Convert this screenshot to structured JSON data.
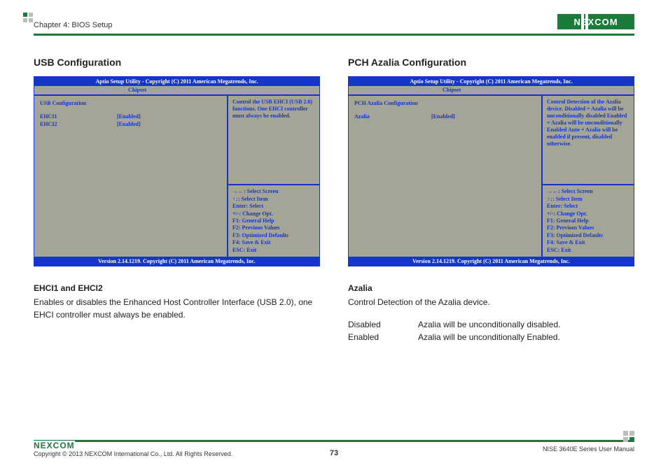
{
  "header": {
    "chapter": "Chapter 4: BIOS Setup",
    "logo": "NEXCOM"
  },
  "left": {
    "title": "USB Configuration",
    "bios": {
      "header": "Aptio Setup Utility - Copyright (C) 2011 American Megatrends, Inc.",
      "tab": "Chipset",
      "section": "USB Configuration",
      "rows": [
        {
          "label": "EHCI1",
          "value": "[Enabled]"
        },
        {
          "label": "EHCI2",
          "value": "[Enabled]"
        }
      ],
      "help": "Control the USB EHCI (USB 2.0) functions. One EHCI controller must always be enabled.",
      "keys": "→←: Select Screen\n↑↓: Select Item\nEnter: Select\n+/-: Change Opt.\nF1: General Help\nF2: Previous Values\nF3: Optimized Defaults\nF4: Save & Exit\nESC: Exit",
      "footer": "Version 2.14.1219. Copyright (C) 2011 American Megatrends, Inc."
    },
    "desc": {
      "heading": "EHCI1 and EHCI2",
      "body": "Enables or disables the Enhanced Host Controller Interface (USB 2.0), one EHCI controller must always be enabled."
    }
  },
  "right": {
    "title": "PCH Azalia Configuration",
    "bios": {
      "header": "Aptio Setup Utility - Copyright (C) 2011 American Megatrends, Inc.",
      "tab": "Chipset",
      "section": "PCH Azalia Configuration",
      "rows": [
        {
          "label": "Azalia",
          "value": "[Enabled]"
        }
      ],
      "help": "Control Detection of the Azalia device. Disabled = Azalia will be unconditionally disabled Enabled = Azalia will be unconditionally Enabled Auto = Azalia will be enabled if present, disabled otherwise.",
      "keys": "→←: Select Screen\n↑↓: Select Item\nEnter: Select\n+/-: Change Opt.\nF1: General Help\nF2: Previous Values\nF3: Optimized Defaults\nF4: Save & Exit\nESC: Exit",
      "footer": "Version 2.14.1219. Copyright (C) 2011 American Megatrends, Inc."
    },
    "desc": {
      "heading": "Azalia",
      "body": "Control Detection of the Azalia device.",
      "table": [
        {
          "k": "Disabled",
          "v": "Azalia will be unconditionally disabled."
        },
        {
          "k": "Enabled",
          "v": "Azalia will be unconditionally Enabled."
        }
      ]
    }
  },
  "footer": {
    "logo": "NEXCOM",
    "copyright": "Copyright © 2013 NEXCOM International Co., Ltd. All Rights Reserved.",
    "page": "73",
    "manual": "NISE 3640E Series User Manual"
  }
}
